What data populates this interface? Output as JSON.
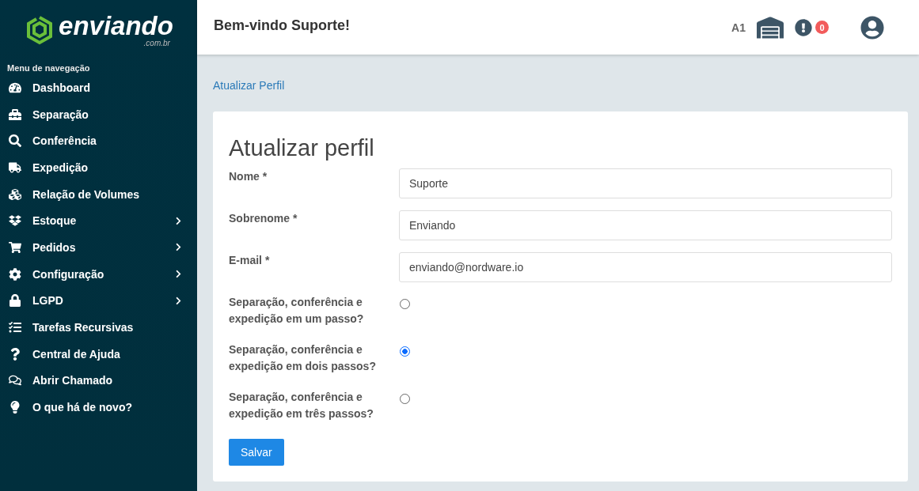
{
  "brand": {
    "name": "enviando",
    "domain": ".com.br"
  },
  "sidebar": {
    "heading": "Menu de navegação",
    "items": [
      {
        "label": "Dashboard",
        "expandable": false
      },
      {
        "label": "Separação",
        "expandable": false
      },
      {
        "label": "Conferência",
        "expandable": false
      },
      {
        "label": "Expedição",
        "expandable": false
      },
      {
        "label": "Relação de Volumes",
        "expandable": false
      },
      {
        "label": "Estoque",
        "expandable": true
      },
      {
        "label": "Pedidos",
        "expandable": true
      },
      {
        "label": "Configuração",
        "expandable": true
      },
      {
        "label": "LGPD",
        "expandable": true
      },
      {
        "label": "Tarefas Recursivas",
        "expandable": false
      },
      {
        "label": "Central de Ajuda",
        "expandable": false
      },
      {
        "label": "Abrir Chamado",
        "expandable": false
      },
      {
        "label": "O que há de novo?",
        "expandable": false
      }
    ]
  },
  "header": {
    "greeting": "Bem-vindo Suporte!",
    "warehouse_code": "A1",
    "alert_count": "0"
  },
  "breadcrumb": "Atualizar Perfil",
  "form": {
    "title": "Atualizar perfil",
    "fields": [
      {
        "label": "Nome *",
        "value": "Suporte"
      },
      {
        "label": "Sobrenome *",
        "value": "Enviando"
      },
      {
        "label": "E-mail *",
        "value": "enviando@nordware.io"
      }
    ],
    "options": [
      {
        "label": "Separação, conferência e expedição em um passo?",
        "selected": false
      },
      {
        "label": "Separação, conferência e expedição em dois passos?",
        "selected": true
      },
      {
        "label": "Separação, conferência e expedição em três passos?",
        "selected": false
      }
    ],
    "submit": "Salvar"
  }
}
